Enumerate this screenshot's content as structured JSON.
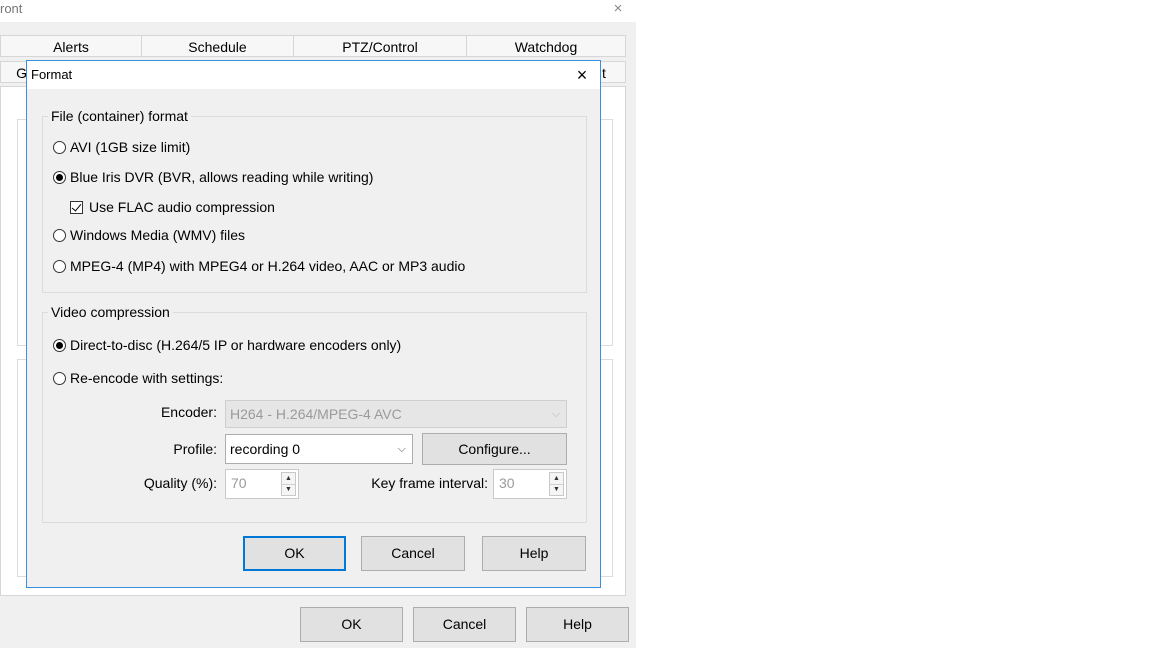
{
  "parent_window": {
    "title": "ront",
    "close_glyph": "×",
    "tabs_row1": [
      "Alerts",
      "Schedule",
      "PTZ/Control",
      "Watchdog"
    ],
    "tabs_row2_left": "G",
    "tabs_row2_right": "t",
    "buttons": {
      "ok": "OK",
      "cancel": "Cancel",
      "help": "Help"
    }
  },
  "dialog": {
    "title": "Format",
    "close_glyph": "×",
    "file_format": {
      "legend": "File (container) format",
      "options": [
        {
          "label": "AVI (1GB size limit)",
          "selected": false
        },
        {
          "label": "Blue Iris DVR (BVR, allows reading while writing)",
          "selected": true
        },
        {
          "label": "Windows Media (WMV) files",
          "selected": false
        },
        {
          "label": "MPEG-4 (MP4) with MPEG4 or H.264 video, AAC or MP3 audio",
          "selected": false
        }
      ],
      "flac": {
        "label": "Use FLAC audio compression",
        "checked": true
      }
    },
    "video_compression": {
      "legend": "Video compression",
      "options": [
        {
          "label": "Direct-to-disc (H.264/5 IP or hardware encoders only)",
          "selected": true
        },
        {
          "label": "Re-encode with settings:",
          "selected": false
        }
      ],
      "encoder_label": "Encoder:",
      "encoder_value": "H264 - H.264/MPEG-4 AVC",
      "profile_label": "Profile:",
      "profile_value": "recording 0",
      "configure_button": "Configure...",
      "quality_label": "Quality (%):",
      "quality_value": "70",
      "keyframe_label": "Key frame interval:",
      "keyframe_value": "30"
    },
    "buttons": {
      "ok": "OK",
      "cancel": "Cancel",
      "help": "Help"
    }
  },
  "icons": {
    "dropdown_arrow": "⌵",
    "spin_up": "▲",
    "spin_down": "▼"
  },
  "colors": {
    "dialog_border": "#3b8ede",
    "default_button_border": "#0078d7",
    "window_bg": "#f0f0f0"
  }
}
